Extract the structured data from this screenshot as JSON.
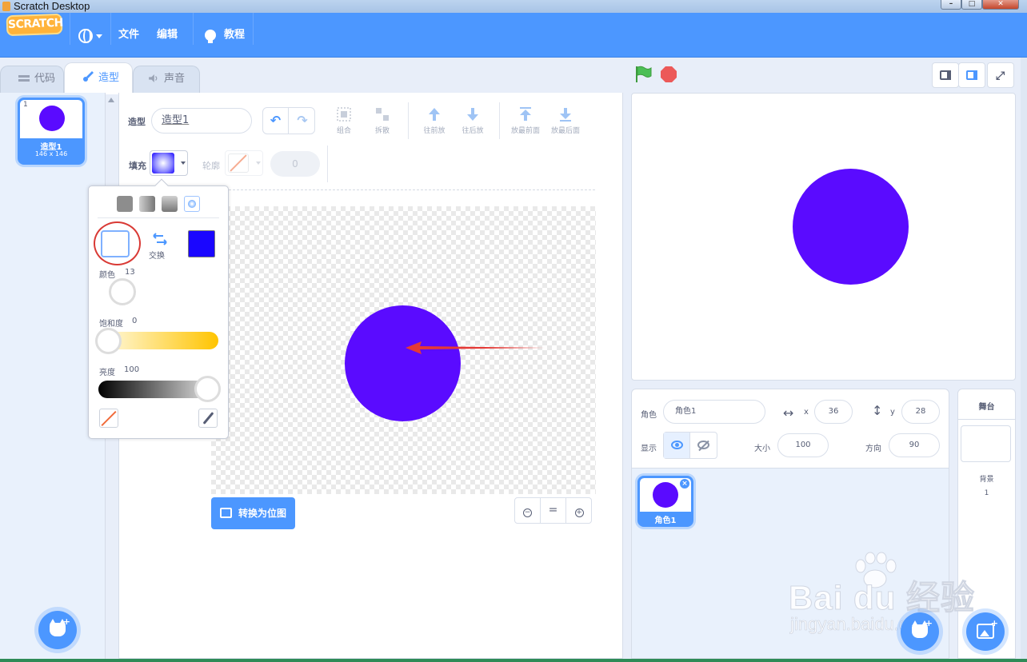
{
  "window": {
    "title": "Scratch Desktop"
  },
  "menubar": {
    "logo": "SCRATCH",
    "file": "文件",
    "edit": "编辑",
    "tutorials": "教程"
  },
  "tabs": [
    {
      "label": "代码"
    },
    {
      "label": "造型"
    },
    {
      "label": "声音"
    }
  ],
  "costume_list": {
    "items": [
      {
        "index": "1",
        "name": "造型1",
        "size": "146 x 146"
      }
    ]
  },
  "editor": {
    "costume_label": "造型",
    "costume_name": "造型1",
    "tools": [
      {
        "label": "组合"
      },
      {
        "label": "拆散"
      },
      {
        "label": "往前放"
      },
      {
        "label": "往后放"
      },
      {
        "label": "放最前面"
      },
      {
        "label": "放最后面"
      }
    ],
    "fill_label": "填充",
    "outline_label": "轮廓",
    "outline_width": "0",
    "convert_button": "转换为位图",
    "zoom_reset": "="
  },
  "color_picker": {
    "swap_label": "交换",
    "color_label": "颜色",
    "color_value": "13",
    "saturation_label": "饱和度",
    "saturation_value": "0",
    "brightness_label": "亮度",
    "brightness_value": "100"
  },
  "sprite_info": {
    "sprite_label": "角色",
    "sprite_name": "角色1",
    "x_label": "x",
    "x_value": "36",
    "y_label": "y",
    "y_value": "28",
    "show_label": "显示",
    "size_label": "大小",
    "size_value": "100",
    "direction_label": "方向",
    "direction_value": "90"
  },
  "sprites": [
    {
      "name": "角色1"
    }
  ],
  "stage_pane": {
    "title": "舞台",
    "backdrops_label": "背景",
    "backdrops_count": "1"
  },
  "watermark": {
    "line1": "Bai du 经验",
    "line2": "jingyan.baidu.com"
  },
  "colors": {
    "accent": "#4c97ff",
    "sprite_fill": "#5a0bff",
    "second_color": "#1a06ff",
    "annotation_red": "#e53935"
  }
}
